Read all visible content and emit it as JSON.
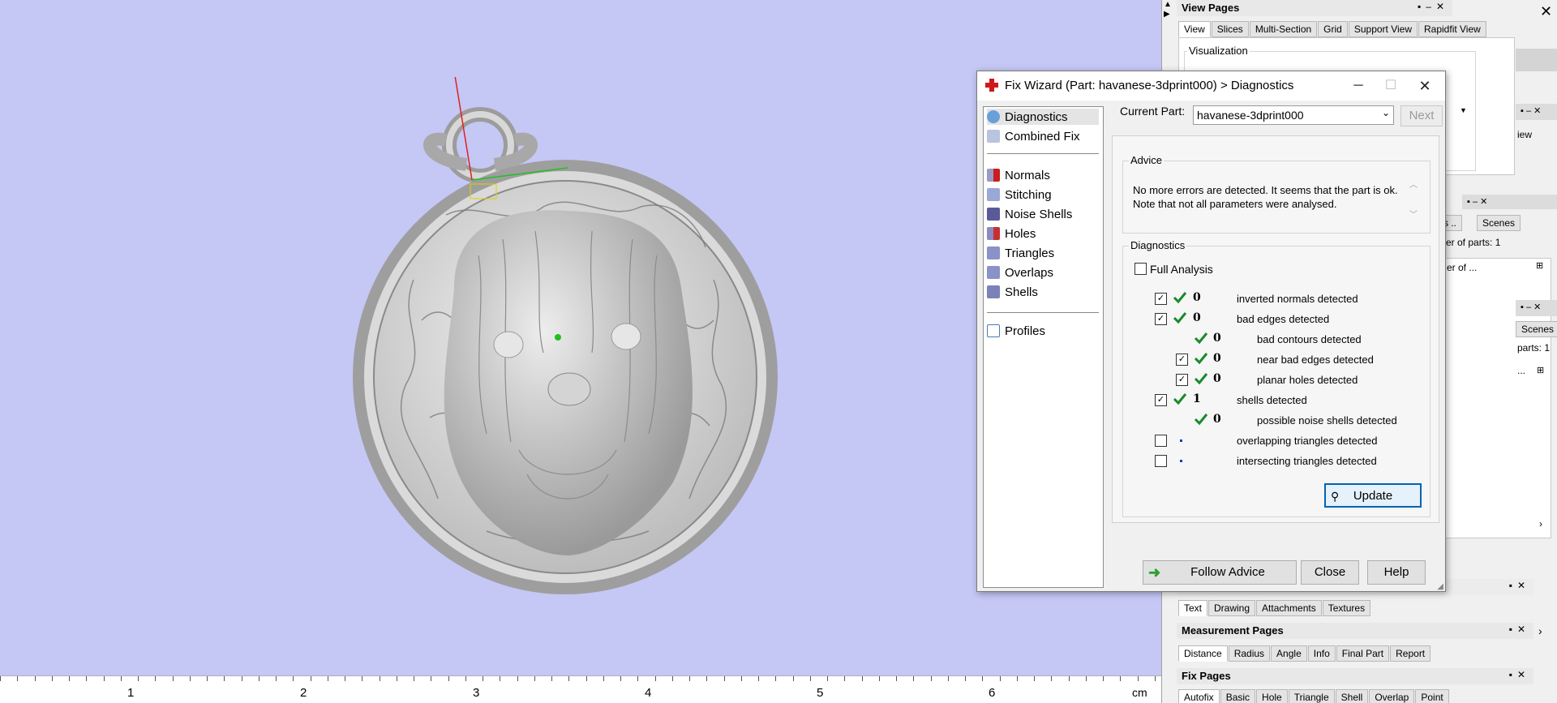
{
  "ruler": {
    "labels": [
      "1",
      "2",
      "3",
      "4",
      "5",
      "6"
    ],
    "unit": "cm"
  },
  "view_pages": {
    "title": "View Pages",
    "tabs": [
      "View",
      "Slices",
      "Multi-Section",
      "Grid",
      "Support View",
      "Rapidfit View"
    ],
    "visualization_label": "Visualization",
    "right_frag1": "iew",
    "right_frag2": "s ..",
    "scenes1": "Scenes",
    "parts1": "er of parts: 1",
    "parts_frag": "er of ...",
    "scenes2": "Scenes",
    "parts2": "parts: 1",
    "dots": "..."
  },
  "text_pages": {
    "tabs": [
      "Text",
      "Drawing",
      "Attachments",
      "Textures"
    ]
  },
  "measurement_pages": {
    "title": "Measurement Pages",
    "tabs": [
      "Distance",
      "Radius",
      "Angle",
      "Info",
      "Final Part",
      "Report"
    ]
  },
  "fix_pages": {
    "title": "Fix Pages",
    "tabs": [
      "Autofix",
      "Basic",
      "Hole",
      "Triangle",
      "Shell",
      "Overlap",
      "Point"
    ]
  },
  "dialog": {
    "title": "Fix Wizard (Part: havanese-3dprint000) > Diagnostics",
    "nav": {
      "top": [
        {
          "label": "Diagnostics",
          "icon": "diagnostics-icon"
        },
        {
          "label": "Combined Fix",
          "icon": "combined-fix-icon"
        }
      ],
      "middle": [
        {
          "label": "Normals",
          "icon": "normals-icon"
        },
        {
          "label": "Stitching",
          "icon": "stitching-icon"
        },
        {
          "label": "Noise Shells",
          "icon": "noise-shells-icon"
        },
        {
          "label": "Holes",
          "icon": "holes-icon"
        },
        {
          "label": "Triangles",
          "icon": "triangles-icon"
        },
        {
          "label": "Overlaps",
          "icon": "overlaps-icon"
        },
        {
          "label": "Shells",
          "icon": "shells-icon"
        }
      ],
      "bottom": [
        {
          "label": "Profiles",
          "icon": "profiles-icon"
        }
      ]
    },
    "current_part_label": "Current Part:",
    "current_part_value": "havanese-3dprint000",
    "next_label": "Next",
    "advice": {
      "label": "Advice",
      "text": "No more errors are detected. It seems that the part is ok. Note that not all parameters were analysed."
    },
    "diagnostics": {
      "label": "Diagnostics",
      "full_analysis_label": "Full Analysis",
      "rows": [
        {
          "count": "0",
          "text": "inverted normals detected"
        },
        {
          "count": "0",
          "text": "bad edges detected"
        },
        {
          "count": "0",
          "text": "bad contours detected"
        },
        {
          "count": "0",
          "text": "near bad edges detected"
        },
        {
          "count": "0",
          "text": "planar holes detected"
        },
        {
          "count": "1",
          "text": "shells detected"
        },
        {
          "count": "0",
          "text": "possible noise shells detected"
        },
        {
          "count": "",
          "text": "overlapping triangles detected"
        },
        {
          "count": "",
          "text": "intersecting triangles detected"
        }
      ]
    },
    "update_label": "Update",
    "follow_advice_label": "Follow Advice",
    "close_label": "Close",
    "help_label": "Help"
  },
  "colors": {
    "viewport_bg": "#c5c7f5",
    "check_green": "#1a8a2a",
    "accent_blue": "#0063b1",
    "red_cross": "#d01818"
  }
}
